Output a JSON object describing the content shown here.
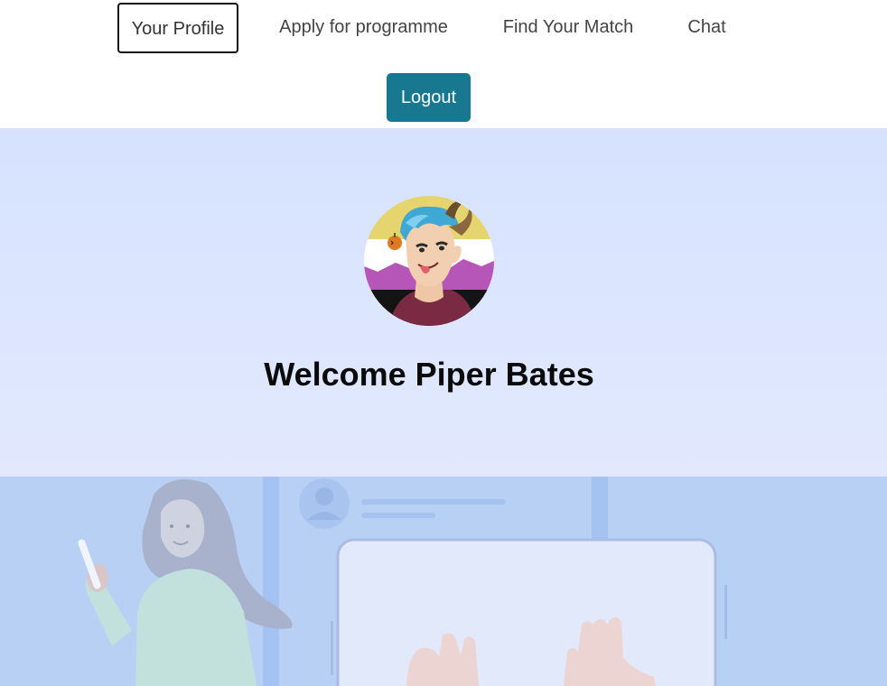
{
  "nav": {
    "items": [
      {
        "label": "Your Profile",
        "active": true
      },
      {
        "label": "Apply for programme",
        "active": false
      },
      {
        "label": "Find Your Match",
        "active": false
      },
      {
        "label": "Chat",
        "active": false
      }
    ],
    "logout_label": "Logout"
  },
  "hero": {
    "welcome_text": "Welcome Piper Bates",
    "avatar_icon": "user-avatar-illustration"
  },
  "illustration": {
    "icon": "video-call-illustration"
  },
  "colors": {
    "logout_bg": "#17788f",
    "hero_top": "#d6e2fe",
    "hero_bottom": "#e2e9fe",
    "illustration_bg": "#b8d0f4",
    "text_dark": "#0a0a0a"
  }
}
